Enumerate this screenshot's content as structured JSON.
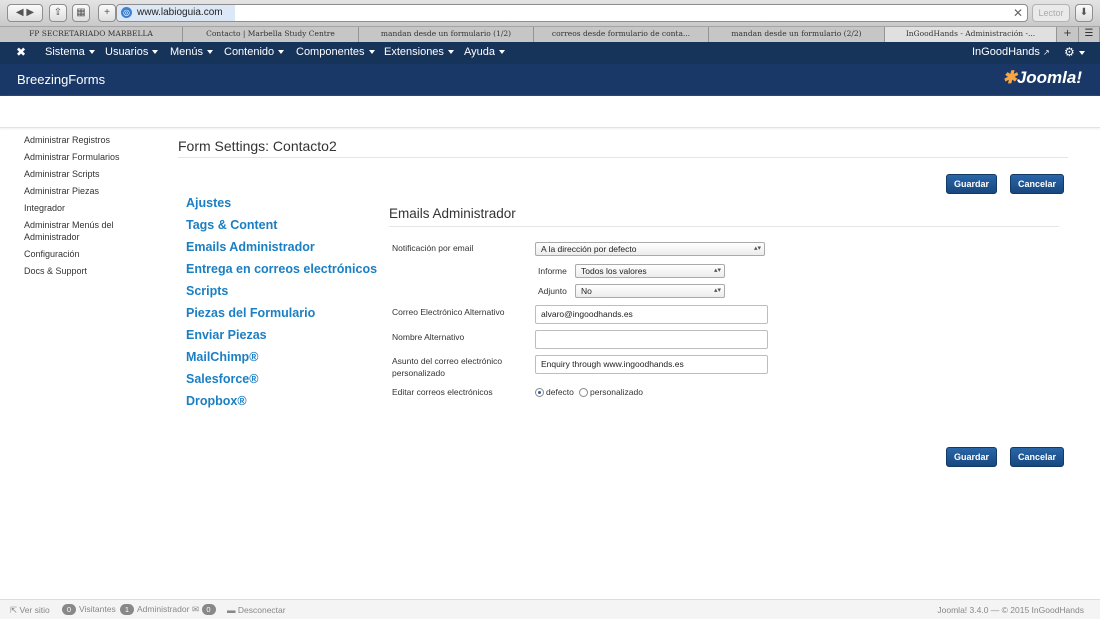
{
  "browser": {
    "url": "www.labioguia.com",
    "reader_label": "Lector",
    "tabs": [
      "FP SECRETARIADO MARBELLA",
      "Contacto | Marbella Study Centre",
      "mandan desde un formulario (1/2)",
      "correos desde formulario de conta...",
      "mandan desde un formulario (2/2)",
      "InGoodHands - Administración -..."
    ]
  },
  "nav": {
    "items": [
      "Sistema",
      "Usuarios",
      "Menús",
      "Contenido",
      "Componentes",
      "Extensiones",
      "Ayuda"
    ],
    "site_link": "InGoodHands"
  },
  "header": {
    "title": "BreezingForms",
    "logo_text": "Joomla!"
  },
  "sidebar": {
    "items": [
      "Administrar Registros",
      "Administrar Formularios",
      "Administrar Scripts",
      "Administrar Piezas",
      "Integrador",
      "Administrar Menús del Administrador",
      "Configuración",
      "Docs & Support"
    ]
  },
  "page": {
    "title": "Form Settings: Contacto2"
  },
  "buttons": {
    "save": "Guardar",
    "cancel": "Cancelar"
  },
  "settings_menu": [
    "Ajustes",
    "Tags & Content",
    "Emails Administrador",
    "Entrega en correos electrónicos",
    "Scripts",
    "Piezas del Formulario",
    "Enviar Piezas",
    "MailChimp®",
    "Salesforce®",
    "Dropbox®"
  ],
  "form": {
    "section_title": "Emails Administrador",
    "notification_label": "Notificación por email",
    "notification_value": "A la dirección por defecto",
    "report_label": "Informe",
    "report_value": "Todos los valores",
    "attachment_label": "Adjunto",
    "attachment_value": "No",
    "alt_email_label": "Correo Electrónico Alternativo",
    "alt_email_value": "alvaro@ingoodhands.es",
    "alt_name_label": "Nombre Alternativo",
    "alt_name_value": "",
    "subject_label": "Asunto del correo electrónico personalizado",
    "subject_value": "Enquiry through www.ingoodhands.es",
    "edit_label": "Editar correos electrónicos",
    "edit_default": "defecto",
    "edit_custom": "personalizado"
  },
  "footer": {
    "view_site": "Ver sitio",
    "visitors_count": "0",
    "visitors_label": "Visitantes",
    "admin_count": "1",
    "admin_label": "Administrador",
    "messages_count": "0",
    "logout": "Desconectar",
    "version": "Joomla! 3.4.0 — © 2015 InGoodHands"
  }
}
